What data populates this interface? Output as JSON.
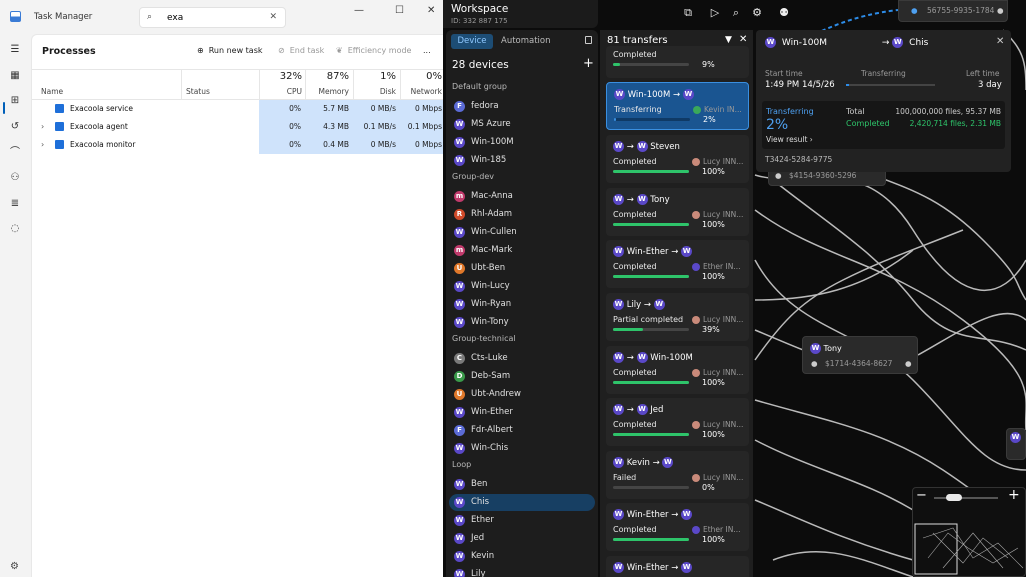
{
  "taskmgr": {
    "title": "Task Manager",
    "search_value": "exa",
    "section": "Processes",
    "toolbar": {
      "run": "Run new task",
      "end": "End task",
      "efficiency": "Efficiency mode",
      "more": "..."
    },
    "columns": {
      "name": "Name",
      "status": "Status",
      "cpu_pct": "32%",
      "cpu": "CPU",
      "mem_pct": "87%",
      "mem": "Memory",
      "disk_pct": "1%",
      "disk": "Disk",
      "net_pct": "0%",
      "net": "Network"
    },
    "rows": [
      {
        "name": "Exacoola service",
        "cpu": "0%",
        "mem": "5.7 MB",
        "disk": "0 MB/s",
        "net": "0 Mbps"
      },
      {
        "name": "Exacoola agent",
        "cpu": "0%",
        "mem": "4.3 MB",
        "disk": "0.1 MB/s",
        "net": "0.1 Mbps"
      },
      {
        "name": "Exacoola monitor",
        "cpu": "0%",
        "mem": "0.4 MB",
        "disk": "0 MB/s",
        "net": "0 Mbps"
      }
    ]
  },
  "workspace": {
    "title": "Workspace",
    "id": "ID: 332 887 175",
    "tabs": {
      "device": "Device",
      "automation": "Automation"
    },
    "device_count": "28 devices",
    "groups": [
      {
        "name": "Default group",
        "devices": [
          {
            "n": "fedora",
            "i": "F",
            "c": "#5b6bd6"
          },
          {
            "n": "MS Azure",
            "i": "W",
            "c": "#5a48c8"
          },
          {
            "n": "Win-100M",
            "i": "W",
            "c": "#5a48c8"
          },
          {
            "n": "Win-185",
            "i": "W",
            "c": "#5a48c8"
          }
        ]
      },
      {
        "name": "Group-dev",
        "devices": [
          {
            "n": "Mac-Anna",
            "i": "m",
            "c": "#c03a6b"
          },
          {
            "n": "Rhl-Adam",
            "i": "R",
            "c": "#d04a2a"
          },
          {
            "n": "Win-Cullen",
            "i": "W",
            "c": "#5a48c8"
          },
          {
            "n": "Mac-Mark",
            "i": "m",
            "c": "#c03a6b"
          },
          {
            "n": "Ubt-Ben",
            "i": "U",
            "c": "#e0782a"
          },
          {
            "n": "Win-Lucy",
            "i": "W",
            "c": "#5a48c8"
          },
          {
            "n": "Win-Ryan",
            "i": "W",
            "c": "#5a48c8"
          },
          {
            "n": "Win-Tony",
            "i": "W",
            "c": "#5a48c8"
          }
        ]
      },
      {
        "name": "Group-technical",
        "devices": [
          {
            "n": "Cts-Luke",
            "i": "C",
            "c": "#7a7a7a"
          },
          {
            "n": "Deb-Sam",
            "i": "D",
            "c": "#3a9a4a"
          },
          {
            "n": "Ubt-Andrew",
            "i": "U",
            "c": "#e0782a"
          },
          {
            "n": "Win-Ether",
            "i": "W",
            "c": "#5a48c8"
          },
          {
            "n": "Fdr-Albert",
            "i": "F",
            "c": "#5b6bd6"
          },
          {
            "n": "Win-Chis",
            "i": "W",
            "c": "#5a48c8"
          }
        ]
      },
      {
        "name": "Loop",
        "devices": [
          {
            "n": "Ben",
            "i": "W",
            "c": "#5a48c8"
          },
          {
            "n": "Chis",
            "i": "W",
            "c": "#5a48c8",
            "sel": true
          },
          {
            "n": "Ether",
            "i": "W",
            "c": "#5a48c8"
          },
          {
            "n": "Jed",
            "i": "W",
            "c": "#5a48c8"
          },
          {
            "n": "Kevin",
            "i": "W",
            "c": "#5a48c8"
          },
          {
            "n": "Lily",
            "i": "W",
            "c": "#5a48c8"
          }
        ]
      }
    ],
    "transfers_title": "81 transfers",
    "transfers": [
      {
        "from": "",
        "to": "",
        "status": "Completed",
        "user": "",
        "pct": "9%",
        "fill": 0.09
      },
      {
        "from": "Win-100M",
        "to": "",
        "status": "Transferring",
        "user": "Kevin IN...",
        "pct": "2%",
        "fill": 0.02,
        "sel": true
      },
      {
        "from": "",
        "to": "Steven",
        "status": "Completed",
        "user": "Lucy INN...",
        "pct": "100%",
        "fill": 1
      },
      {
        "from": "",
        "to": "Tony",
        "status": "Completed",
        "user": "Lucy INN...",
        "pct": "100%",
        "fill": 1
      },
      {
        "from": "Win-Ether",
        "to": "",
        "status": "Completed",
        "user": "Ether IN...",
        "pct": "100%",
        "fill": 1
      },
      {
        "from": "Lily",
        "to": "",
        "status": "Partial completed",
        "user": "Lucy INN...",
        "pct": "39%",
        "fill": 0.39
      },
      {
        "from": "",
        "to": "Win-100M",
        "status": "Completed",
        "user": "Lucy INN...",
        "pct": "100%",
        "fill": 1
      },
      {
        "from": "",
        "to": "Jed",
        "status": "Completed",
        "user": "Lucy INN...",
        "pct": "100%",
        "fill": 1
      },
      {
        "from": "Kevin",
        "to": "",
        "status": "Failed",
        "user": "Lucy INN...",
        "pct": "0%",
        "fill": 0
      },
      {
        "from": "Win-Ether",
        "to": "",
        "status": "Completed",
        "user": "Ether IN...",
        "pct": "100%",
        "fill": 1
      },
      {
        "from": "Win-Ether",
        "to": "",
        "status": "",
        "user": "",
        "pct": "",
        "fill": 0
      }
    ],
    "detail": {
      "from": "Win-100M",
      "to": "Chis",
      "start_label": "Start time",
      "start": "1:49 PM 14/5/26",
      "status_label": "Transferring",
      "left_label": "Left time",
      "left": "3 day",
      "state": "Transferring",
      "pct": "2%",
      "total_label": "Total",
      "total": "100,000,000 files, 95.37 MB",
      "completed_label": "Completed",
      "completed": "2,420,714 files, 2.31 MB",
      "view": "View result",
      "id": "T3424-5284-9775"
    },
    "graph": {
      "top_id": "56755-9935-1784",
      "id2": "$4154-9360-5296",
      "tony_name": "Tony",
      "tony_id": "$1714-4364-8627"
    },
    "colors": {
      "accent": "#2d8ce8",
      "progress": "#2ec46a",
      "panel": "#1d1d1d"
    }
  }
}
